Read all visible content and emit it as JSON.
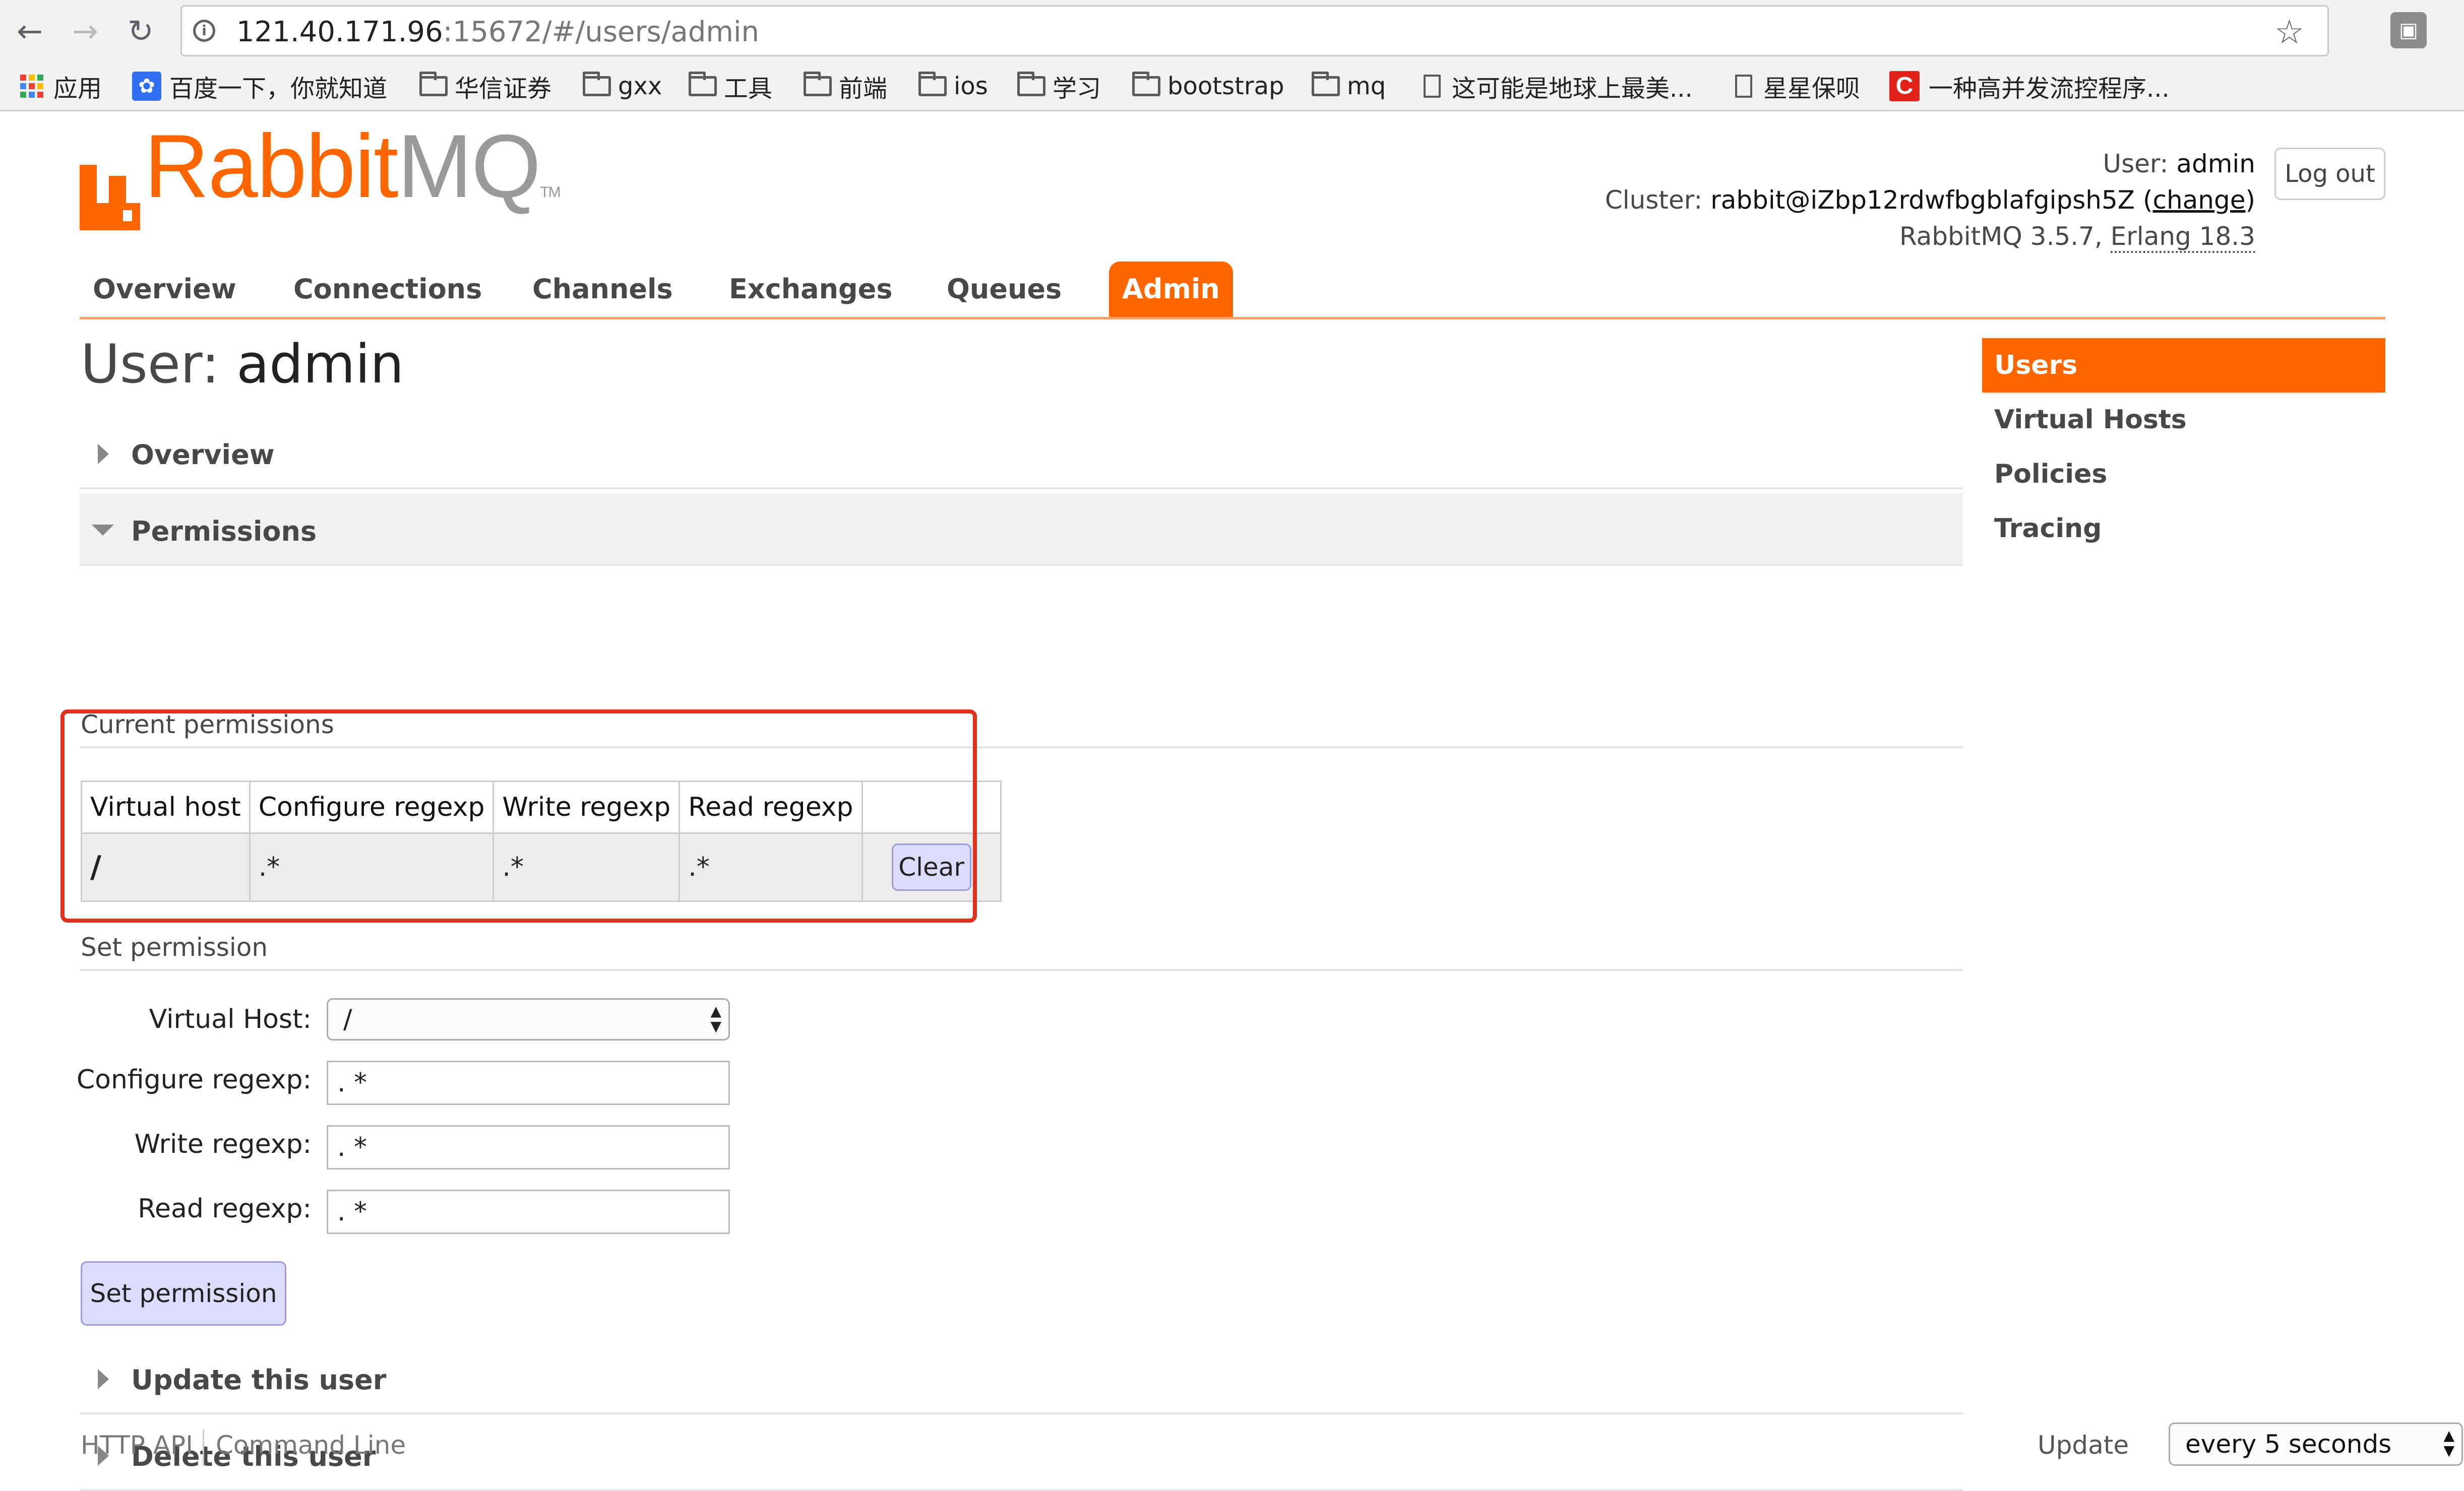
{
  "browser": {
    "url_host": "121.40.171.96",
    "url_path": ":15672/#/users/admin",
    "bookmarks": [
      {
        "label": "应用",
        "icon": "apps-grid-icon"
      },
      {
        "label": "百度一下，你就知道",
        "icon": "baidu-paw-icon"
      },
      {
        "label": "华信证券",
        "icon": "folder-icon"
      },
      {
        "label": "gxx",
        "icon": "folder-icon"
      },
      {
        "label": "工具",
        "icon": "folder-icon"
      },
      {
        "label": "前端",
        "icon": "folder-icon"
      },
      {
        "label": "ios",
        "icon": "folder-icon"
      },
      {
        "label": "学习",
        "icon": "folder-icon"
      },
      {
        "label": "bootstrap",
        "icon": "folder-icon"
      },
      {
        "label": "mq",
        "icon": "folder-icon"
      },
      {
        "label": "这可能是地球上最美...",
        "icon": "page-icon"
      },
      {
        "label": "星星保呗",
        "icon": "page-icon"
      },
      {
        "label": "一种高并发流控程序...",
        "icon": "c-logo-icon"
      }
    ]
  },
  "header": {
    "logo_text_rabbit": "Rabbit",
    "logo_text_mq": "MQ",
    "logo_tm": "TM",
    "user_label": "User:",
    "user_value": "admin",
    "cluster_label": "Cluster:",
    "cluster_value": "rabbit@iZbp12rdwfbgblafgipsh5Z",
    "change_link": "change",
    "version_text": "RabbitMQ 3.5.7,",
    "erlang_text": "Erlang 18.3",
    "logout_label": "Log out"
  },
  "tabs": [
    {
      "label": "Overview",
      "active": false
    },
    {
      "label": "Connections",
      "active": false
    },
    {
      "label": "Channels",
      "active": false
    },
    {
      "label": "Exchanges",
      "active": false
    },
    {
      "label": "Queues",
      "active": false
    },
    {
      "label": "Admin",
      "active": true
    }
  ],
  "main": {
    "title_label": "User:",
    "title_value": "admin",
    "sections": {
      "overview": "Overview",
      "permissions": "Permissions",
      "update_user": "Update this user",
      "delete_user": "Delete this user"
    },
    "current_permissions": {
      "heading": "Current permissions",
      "columns": [
        "Virtual host",
        "Configure regexp",
        "Write regexp",
        "Read regexp"
      ],
      "rows": [
        {
          "vhost": "/",
          "configure": ".*",
          "write": ".*",
          "read": ".*"
        }
      ],
      "clear_label": "Clear"
    },
    "set_permission": {
      "heading": "Set permission",
      "vhost_label": "Virtual Host:",
      "vhost_value": "/",
      "configure_label": "Configure regexp:",
      "configure_value": ". *",
      "write_label": "Write regexp:",
      "write_value": ". *",
      "read_label": "Read regexp:",
      "read_value": ". *",
      "button_label": "Set permission"
    }
  },
  "right_nav": [
    {
      "label": "Users",
      "active": true
    },
    {
      "label": "Virtual Hosts",
      "active": false
    },
    {
      "label": "Policies",
      "active": false
    },
    {
      "label": "Tracing",
      "active": false
    }
  ],
  "footer": {
    "http_api": "HTTP API",
    "command_line": "Command Line",
    "update_label": "Update",
    "update_value": "every 5 seconds"
  },
  "colors": {
    "accent": "#ff6600",
    "highlight_box": "#e0301e",
    "button_purple": "#dcdcff"
  }
}
